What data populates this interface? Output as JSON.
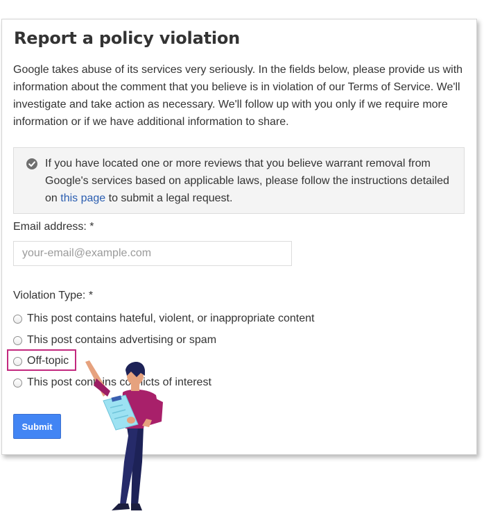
{
  "form": {
    "title": "Report a policy violation",
    "intro": "Google takes abuse of its services very seriously. In the fields below, please provide us with information about the comment that you believe is in violation of our Terms of Service. We'll investigate and take action as necessary. We'll follow up with you only if we require more information or if we have additional information to share.",
    "notice": {
      "icon": "check-circle-icon",
      "text_before": "If you have located one or more reviews that you believe warrant removal from Google's services based on applicable laws, please follow the instructions detailed on ",
      "link_text": "this page",
      "text_after": " to submit a legal request."
    },
    "email": {
      "label": "Email address: *",
      "placeholder": "your-email@example.com",
      "value": ""
    },
    "violation": {
      "label": "Violation Type: *",
      "options": [
        "This post contains hateful, violent, or inappropriate content",
        "This post contains advertising or spam",
        "Off-topic",
        "This post contains conflicts of interest"
      ],
      "highlighted_option": "Off-topic"
    },
    "submit_label": "Submit"
  },
  "colors": {
    "highlight": "#c2287e",
    "submit_bg": "#4285f4",
    "link": "#2a5db0"
  }
}
